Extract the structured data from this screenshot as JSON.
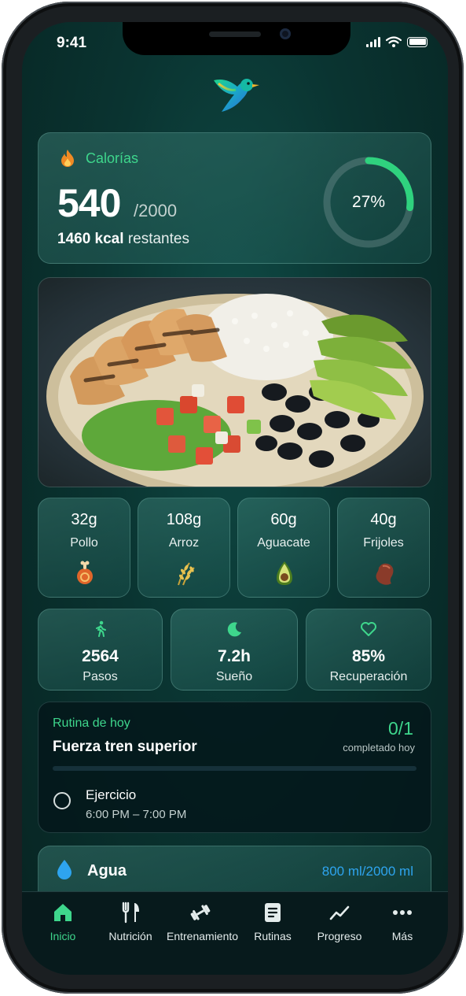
{
  "status_bar": {
    "time": "9:41"
  },
  "calories": {
    "label": "Calorías",
    "consumed": "540",
    "goal": "/2000",
    "remaining_value": "1460 kcal",
    "remaining_label": "restantes",
    "percent_label": "27%",
    "progress": 0.27,
    "accent_color": "#3ed68c"
  },
  "macros": [
    {
      "amount": "32g",
      "name": "Pollo",
      "icon": "chicken-leg-icon"
    },
    {
      "amount": "108g",
      "name": "Arroz",
      "icon": "rice-grain-icon"
    },
    {
      "amount": "60g",
      "name": "Aguacate",
      "icon": "avocado-icon"
    },
    {
      "amount": "40g",
      "name": "Frijoles",
      "icon": "bean-icon"
    }
  ],
  "stats": [
    {
      "value": "2564",
      "label": "Pasos",
      "icon": "walking-icon"
    },
    {
      "value": "7.2h",
      "label": "Sueño",
      "icon": "moon-icon"
    },
    {
      "value": "85%",
      "label": "Recuperación",
      "icon": "heart-icon"
    }
  ],
  "routine": {
    "tag": "Rutina de hoy",
    "title": "Fuerza tren superior",
    "count": "0/1",
    "count_sub": "completado hoy",
    "progress": 0,
    "item": {
      "name": "Ejercicio",
      "time": "6:00 PM – 7:00 PM"
    }
  },
  "water": {
    "label": "Agua",
    "value": "800 ml/2000 ml",
    "color": "#2ea4ef"
  },
  "tabs": [
    {
      "label": "Inicio",
      "icon": "home-icon",
      "active": true
    },
    {
      "label": "Nutrición",
      "icon": "fork-knife-icon",
      "active": false
    },
    {
      "label": "Entrenamiento",
      "icon": "dumbbell-icon",
      "active": false
    },
    {
      "label": "Rutinas",
      "icon": "clipboard-icon",
      "active": false
    },
    {
      "label": "Progreso",
      "icon": "trend-line-icon",
      "active": false
    },
    {
      "label": "Más",
      "icon": "more-dots-icon",
      "active": false
    }
  ]
}
